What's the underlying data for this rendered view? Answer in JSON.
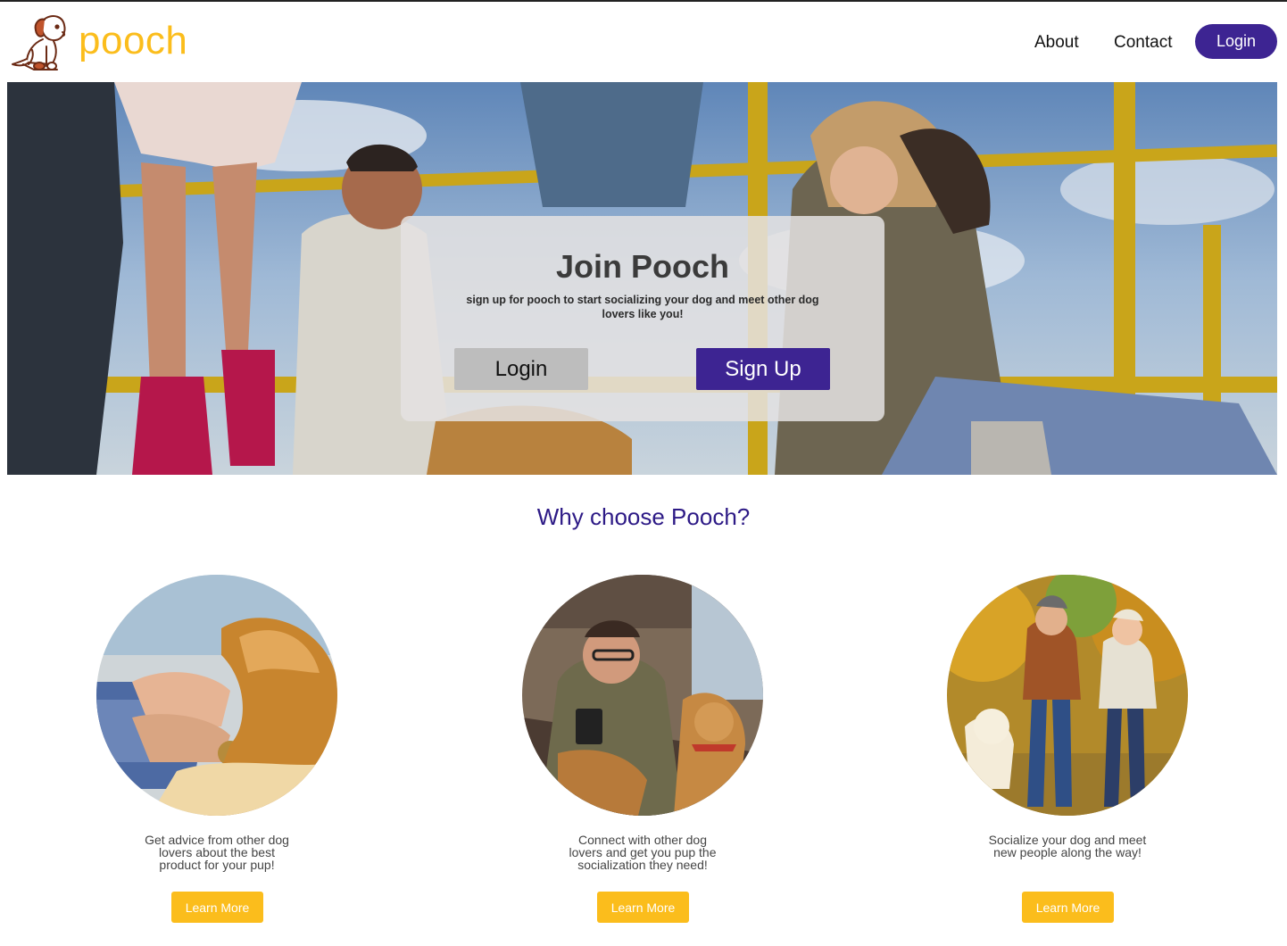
{
  "brand": {
    "name": "pooch",
    "logo_icon": "puppy-logo-icon",
    "color": "#fbbd1c"
  },
  "nav": {
    "about": "About",
    "contact": "Contact",
    "login": "Login"
  },
  "hero": {
    "title": "Join Pooch",
    "subtitle": "sign up for pooch to start socializing your dog and meet other dog lovers like you!",
    "login_label": "Login",
    "signup_label": "Sign Up"
  },
  "why": {
    "title": "Why choose Pooch?",
    "features": [
      {
        "text": "Get advice from other dog lovers about the best product for your pup!",
        "button": "Learn More"
      },
      {
        "text": "Connect with other dog lovers and get you pup the socialization they need!",
        "button": "Learn More"
      },
      {
        "text": "Socialize your dog and meet new people along the way!",
        "button": "Learn More"
      }
    ]
  },
  "colors": {
    "primary": "#3d2492",
    "accent": "#fbbd1c",
    "heading": "#2d1a86"
  }
}
